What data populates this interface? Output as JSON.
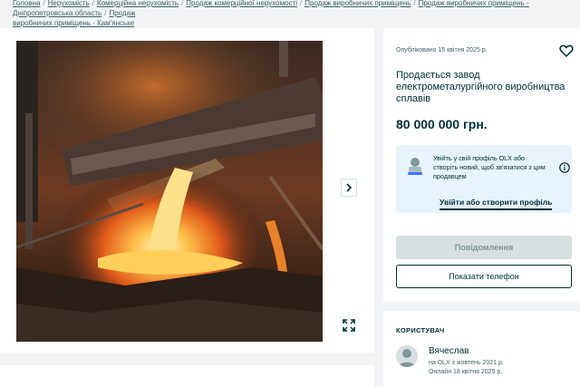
{
  "breadcrumb": {
    "items": [
      "Головна",
      "Нерухомість",
      "Комерційна нерухомість",
      "Продаж комерційної нерухомості",
      "Продаж виробничих приміщень",
      "Продаж виробничих приміщень - Дніпропетровська область",
      "Продаж"
    ],
    "line2": "виробничих приміщень - Кам'янське"
  },
  "listing": {
    "published": "Опубліковано 15 квітня 2025 р.",
    "title": "Продається завод електрометалургійного виробництва сплавів",
    "price": "80 000 000 грн."
  },
  "promo": {
    "text": "Увійть у свій профіль OLX або створіть новий, щоб зв'язатися з цим продавцем",
    "link": "Увійти або створити профіль"
  },
  "buttons": {
    "message": "Повідомлення",
    "phone": "Показати телефон"
  },
  "user": {
    "heading": "КОРИСТУВАЧ",
    "name": "Вячеслав",
    "since": "на OLX з жовтень 2021 р.",
    "online": "Онлайн 18 квітня 2025 р."
  },
  "icons": {
    "next": "chevron-right-icon",
    "expand": "expand-icon",
    "favorite": "heart-icon",
    "info": "info-icon"
  },
  "colors": {
    "primary": "#002f34",
    "promo_bg": "#e8f3fc",
    "disabled_button": "#d8dfe0"
  }
}
